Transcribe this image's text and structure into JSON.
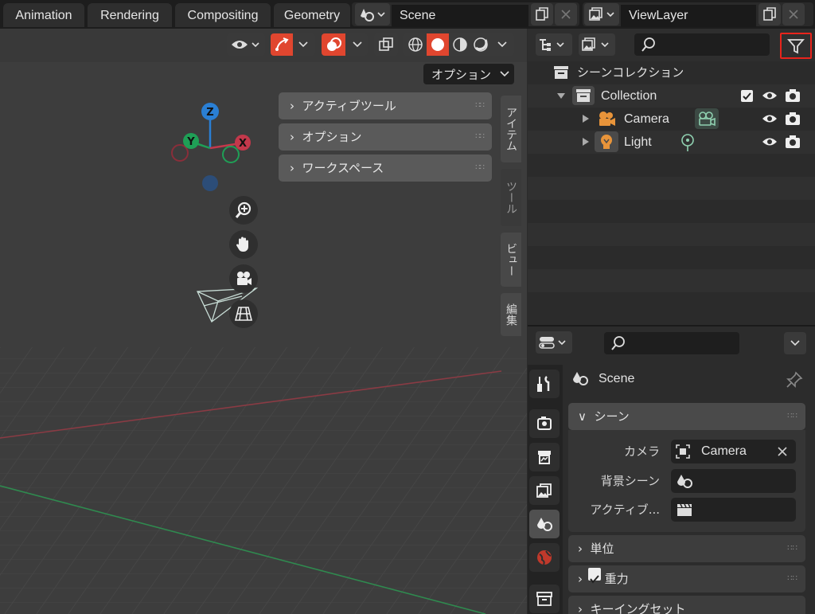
{
  "top_tabs": [
    "Animation",
    "Rendering",
    "Compositing",
    "Geometry"
  ],
  "scene_selector": {
    "value": "Scene"
  },
  "viewlayer_selector": {
    "value": "ViewLayer"
  },
  "viewport": {
    "options_label": "オプション",
    "panels": [
      "アクティブツール",
      "オプション",
      "ワークスペース"
    ],
    "side_tabs": [
      "アイテム",
      "ツール",
      "ビュー",
      "編集"
    ],
    "gizmo": {
      "z": "Z",
      "y": "Y",
      "x": "X"
    }
  },
  "outliner": {
    "scene_collection": "シーンコレクション",
    "collection": "Collection",
    "items": [
      "Camera",
      "Light"
    ]
  },
  "properties": {
    "scene_title": "Scene",
    "section_scene": "シーン",
    "camera_label": "カメラ",
    "camera_value": "Camera",
    "bg_scene_label": "背景シーン",
    "active_label": "アクティブ...",
    "section_units": "単位",
    "section_gravity": "重力",
    "section_keying": "キーイングセット"
  },
  "colors": {
    "accent_red": "#e0462f",
    "highlight_border": "#e8241c",
    "x_axis": "#c3384b",
    "y_axis": "#1f9f56",
    "z_axis": "#2a7fd4"
  }
}
